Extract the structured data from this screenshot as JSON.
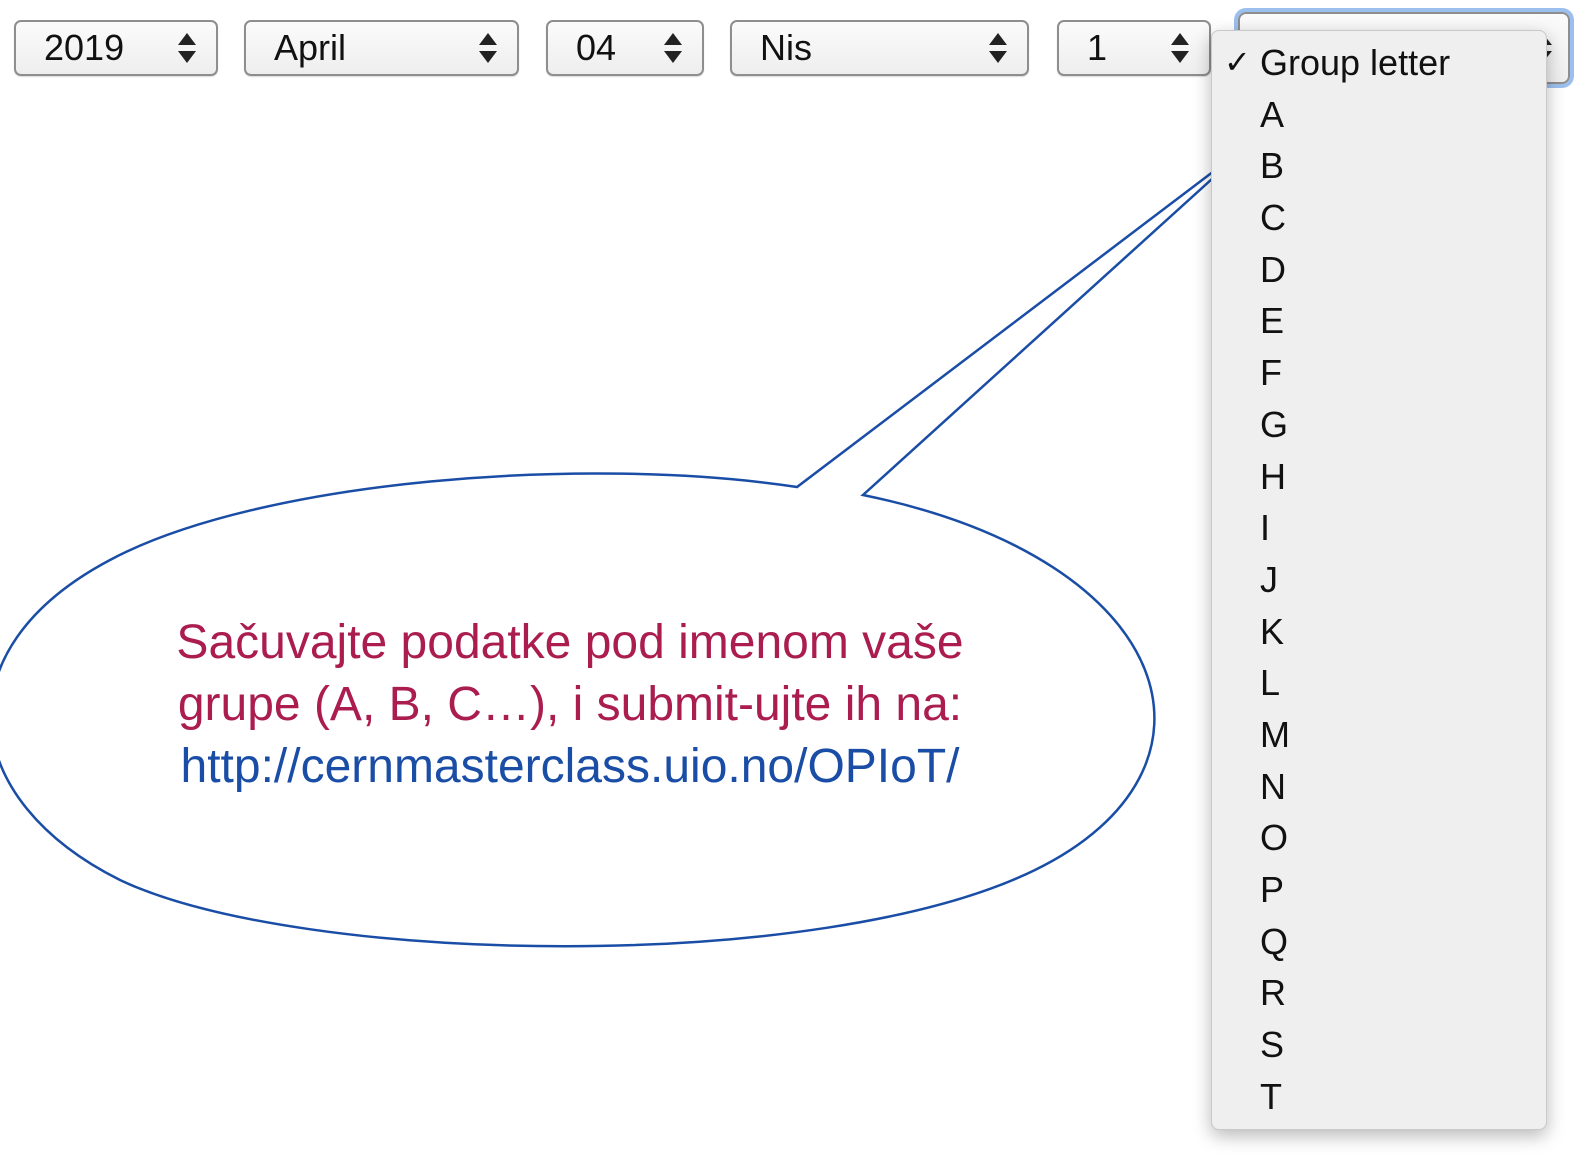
{
  "selects": {
    "year": "2019",
    "month": "April",
    "day": "04",
    "weekday": "Nis",
    "number": "1"
  },
  "group_menu": {
    "selected_label": "Group letter",
    "options": [
      "A",
      "B",
      "C",
      "D",
      "E",
      "F",
      "G",
      "H",
      "I",
      "J",
      "K",
      "L",
      "M",
      "N",
      "O",
      "P",
      "Q",
      "R",
      "S",
      "T"
    ]
  },
  "callout": {
    "line1": "Sačuvajte podatke pod imenom vaše",
    "line2": "grupe (A, B, C…), i submit-ujte ih na:",
    "link": "http://cernmasterclass.uio.no/OPIoT/"
  },
  "colors": {
    "callout_text": "#ab1c4f",
    "callout_link": "#1a4da6",
    "callout_outline": "#1a4da6",
    "menu_bg": "#efefef"
  }
}
